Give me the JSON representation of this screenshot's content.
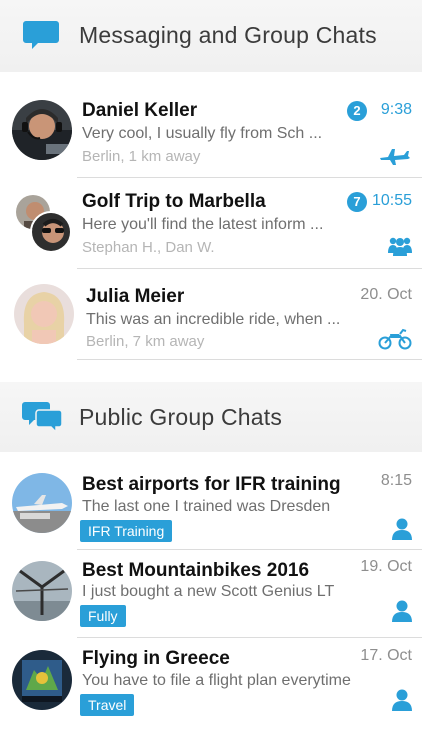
{
  "colors": {
    "accent": "#2a9fd8",
    "header_bg": "#f3f3f3",
    "divider": "#dcdcdc"
  },
  "sections": {
    "messaging": {
      "title": "Messaging and Group Chats",
      "icon": "chat-bubble-icon"
    },
    "public": {
      "title": "Public Group Chats",
      "icon": "double-chat-bubbles-icon"
    }
  },
  "chats": [
    {
      "name": "Daniel Keller",
      "message": "Very cool, I usually fly from Sch ...",
      "sub": "Berlin, 1 km away",
      "time": "9:38",
      "unread": "2",
      "type_icon": "airplane-icon"
    },
    {
      "name": "Golf Trip to Marbella",
      "message": "Here you'll find the latest inform ...",
      "sub": "Stephan H., Dan W.",
      "time": "10:55",
      "unread": "7",
      "type_icon": "group-icon"
    },
    {
      "name": "Julia Meier",
      "message": "This was an incredible ride, when ...",
      "sub": "Berlin, 7 km away",
      "time": "20. Oct",
      "type_icon": "motorcycle-icon"
    }
  ],
  "public_chats": [
    {
      "name": "Best airports for IFR training",
      "message": "The last one I trained was Dresden",
      "tag": "IFR Training",
      "time": "8:15",
      "type_icon": "person-icon"
    },
    {
      "name": "Best Mountainbikes 2016",
      "message": "I just bought a new Scott Genius LT",
      "tag": "Fully",
      "time": "19. Oct",
      "type_icon": "person-icon"
    },
    {
      "name": "Flying in Greece",
      "message": "You have to file a flight plan everytime",
      "tag": "Travel",
      "time": "17. Oct",
      "type_icon": "person-icon"
    }
  ]
}
